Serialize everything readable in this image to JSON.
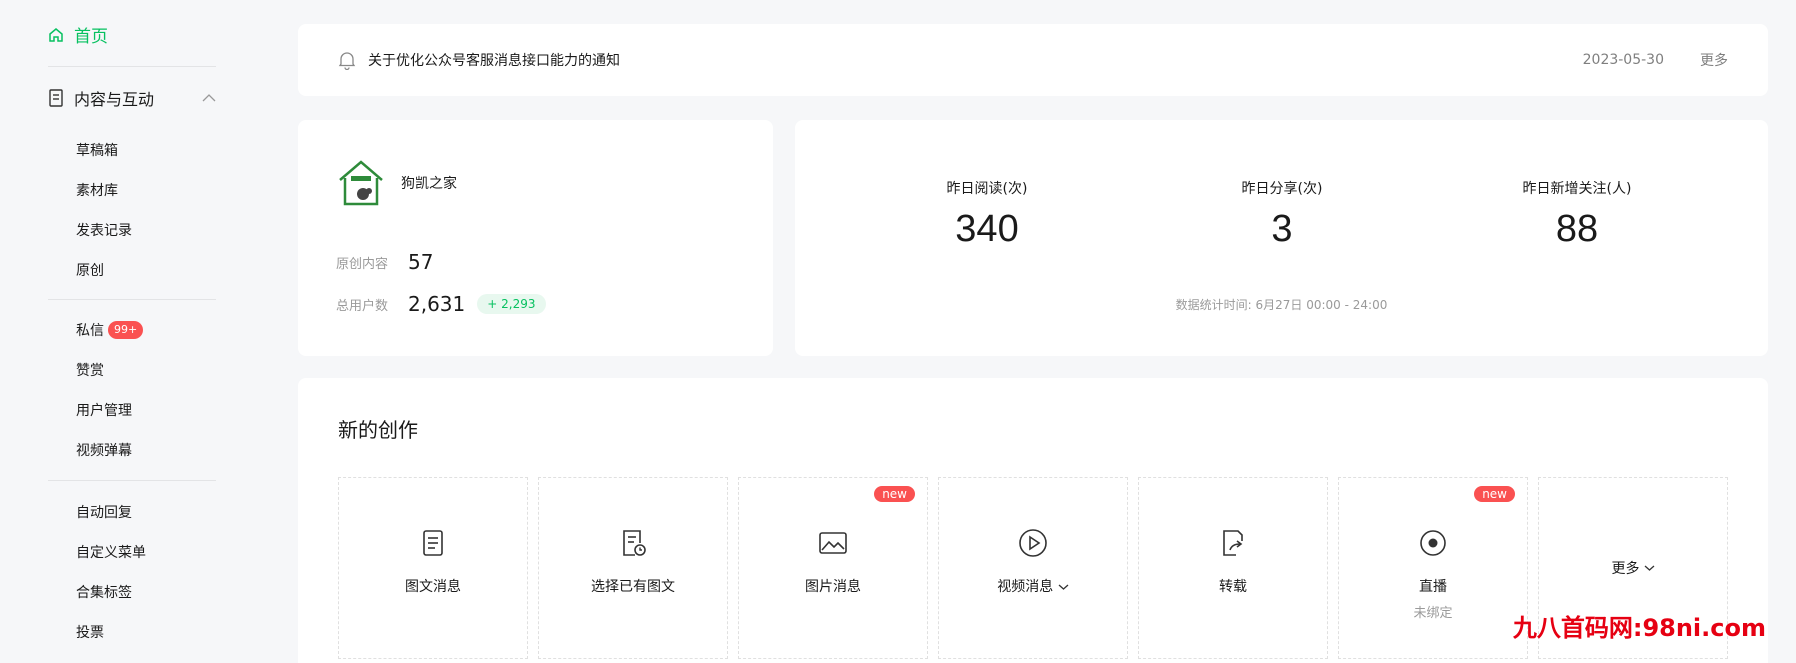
{
  "sidebar": {
    "home": "首页",
    "group": "内容与互动",
    "items": [
      "草稿箱",
      "素材库",
      "发表记录",
      "原创"
    ],
    "items2": [
      "私信",
      "赞赏",
      "用户管理",
      "视频弹幕"
    ],
    "private_badge": "99+",
    "items3": [
      "自动回复",
      "自定义菜单",
      "合集标签",
      "投票"
    ]
  },
  "notice": {
    "text": "关于优化公众号客服消息接口能力的通知",
    "date": "2023-05-30",
    "more": "更多"
  },
  "account": {
    "name": "狗凯之家",
    "original_label": "原创内容",
    "original_value": "57",
    "users_label": "总用户数",
    "users_value": "2,631",
    "users_growth": "+ 2,293"
  },
  "yesterday": {
    "reads_label": "昨日阅读(次)",
    "reads_value": "340",
    "shares_label": "昨日分享(次)",
    "shares_value": "3",
    "follows_label": "昨日新增关注(人)",
    "follows_value": "88",
    "time_note": "数据统计时间: 6月27日 00:00 - 24:00"
  },
  "create": {
    "title": "新的创作",
    "tiles": [
      {
        "label": "图文消息"
      },
      {
        "label": "选择已有图文"
      },
      {
        "label": "图片消息",
        "badge": "new"
      },
      {
        "label": "视频消息"
      },
      {
        "label": "转载"
      },
      {
        "label": "直播",
        "sub": "未绑定",
        "badge": "new"
      },
      {
        "label": "更多"
      }
    ]
  },
  "watermark": "九八首码网:98ni.com",
  "colors": {
    "accent": "#07c160",
    "badge": "#fa5151"
  }
}
